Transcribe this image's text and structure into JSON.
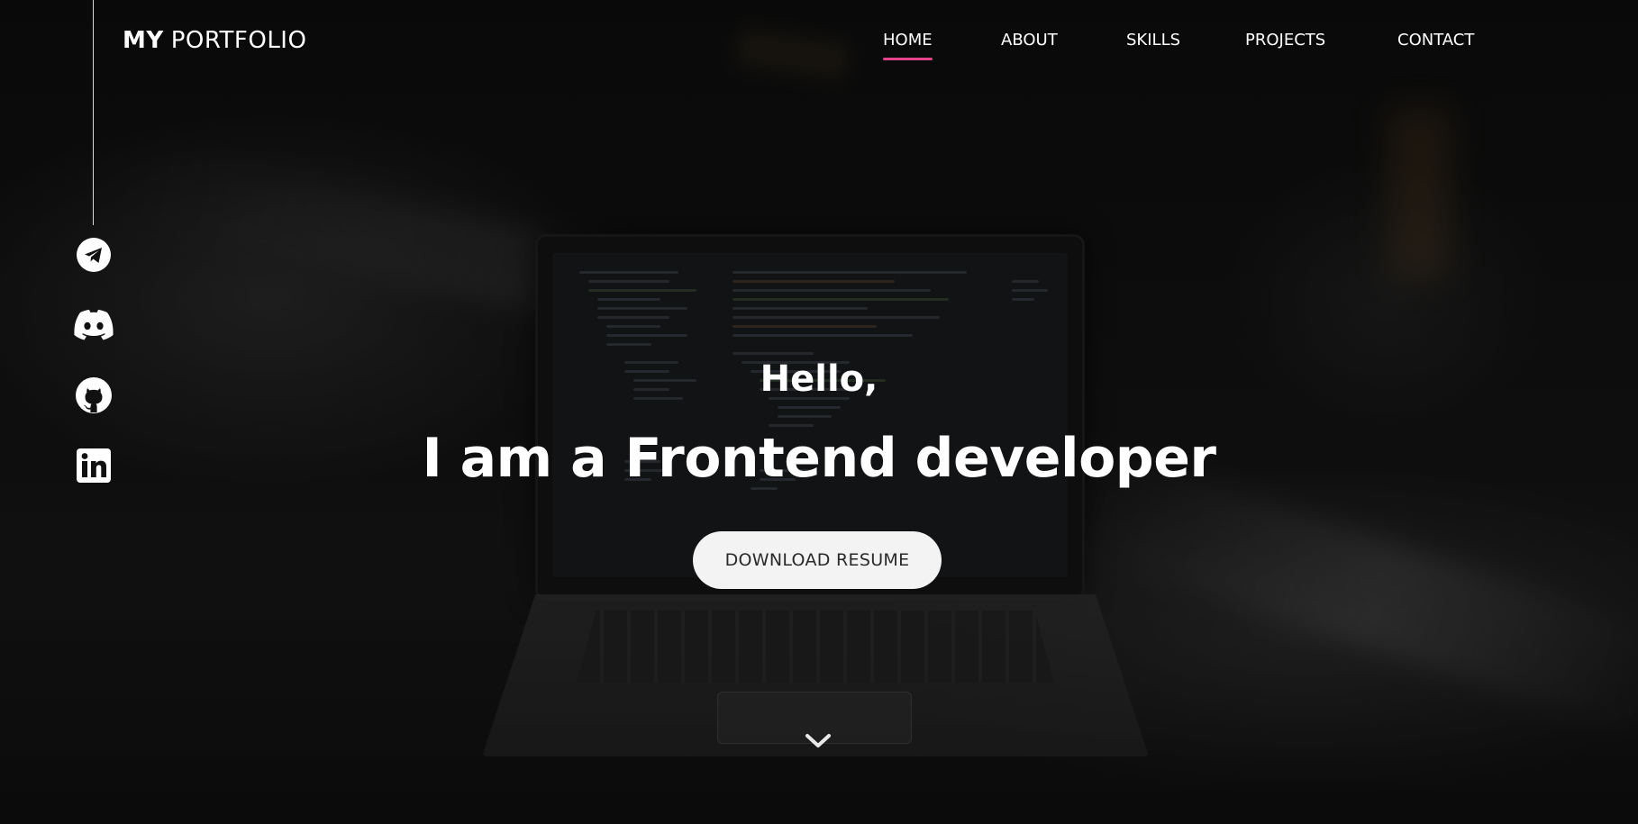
{
  "navbar": {
    "brand_bold": "MY",
    "brand_light": "PORTFOLIO",
    "links": [
      {
        "label": "HOME",
        "active": true
      },
      {
        "label": "ABOUT",
        "active": false
      },
      {
        "label": "SKILLS",
        "active": false
      },
      {
        "label": "PROJECTS",
        "active": false
      },
      {
        "label": "CONTACT",
        "active": false
      }
    ]
  },
  "social": [
    {
      "icon": "telegram-icon"
    },
    {
      "icon": "discord-icon"
    },
    {
      "icon": "github-icon"
    },
    {
      "icon": "linkedin-icon"
    }
  ],
  "hero": {
    "greeting": "Hello,",
    "headline": "I am a Frontend developer",
    "cta_label": "DOWNLOAD RESUME",
    "scroll_icon": "chevron-down-icon"
  },
  "colors": {
    "accent": "#e0458b",
    "text": "#ffffff",
    "button_bg": "#f3f3f3",
    "button_text": "#2a2a2a"
  }
}
